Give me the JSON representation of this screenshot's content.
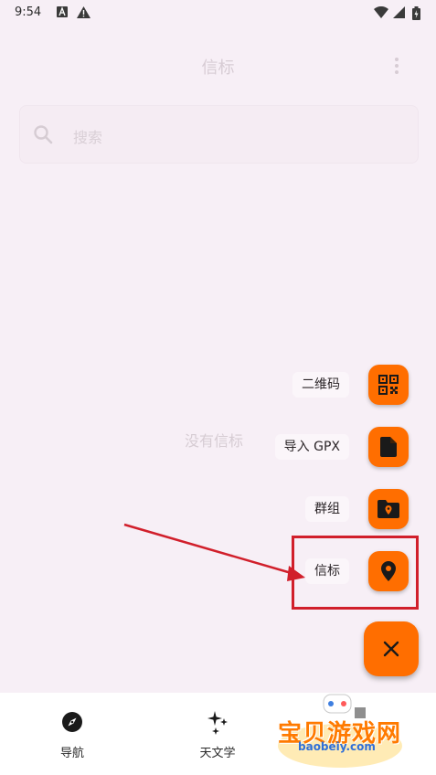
{
  "status": {
    "time": "9:54"
  },
  "app": {
    "title": "信标"
  },
  "search": {
    "placeholder": "搜索"
  },
  "empty": {
    "message": "没有信标"
  },
  "fab_menu": {
    "items": [
      {
        "label": "二维码",
        "icon": "qr-code-icon"
      },
      {
        "label": "导入 GPX",
        "icon": "file-icon"
      },
      {
        "label": "群组",
        "icon": "folder-pin-icon"
      },
      {
        "label": "信标",
        "icon": "location-pin-icon"
      }
    ],
    "close_icon": "close-icon"
  },
  "nav": {
    "items": [
      {
        "label": "导航",
        "icon": "compass-icon"
      },
      {
        "label": "天文学",
        "icon": "sparkle-icon"
      }
    ]
  },
  "watermark": {
    "title": "宝贝游戏网",
    "url": "baobeiy.com"
  },
  "colors": {
    "accent": "#ff6e00",
    "highlight": "#d11f2b",
    "background": "#f7eff6"
  }
}
